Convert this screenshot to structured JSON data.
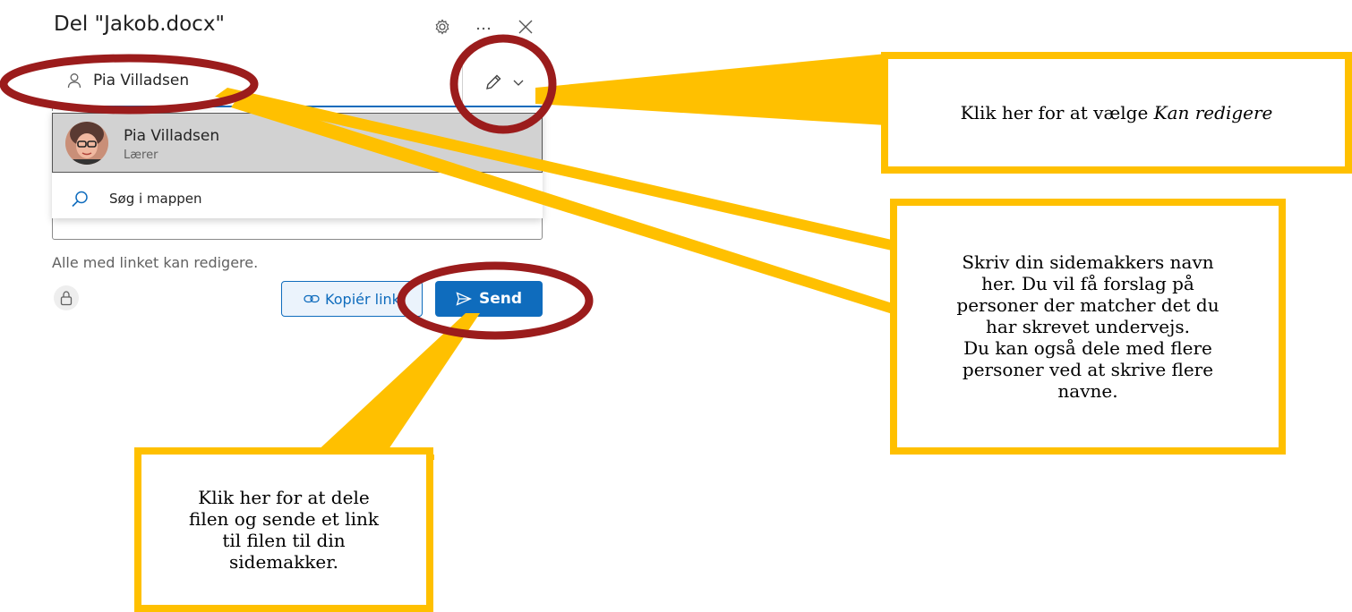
{
  "dialog": {
    "title": "Del \"Jakob.docx\"",
    "header_icons": [
      "gear-icon",
      "more-icon",
      "close-icon"
    ],
    "recipient": "Pia Villadsen",
    "suggestion": {
      "name": "Pia Villadsen",
      "role": "Lærer"
    },
    "search_folder_label": "Søg i mappen",
    "link_status": "Alle med linket kan redigere.",
    "copy_link_label": "Kopiér link",
    "send_label": "Send"
  },
  "callouts": {
    "edit_prefix": "Klik her for at vælge ",
    "edit_emphasis": "Kan redigere",
    "names": "Skriv din sidemakkers navn\nher. Du vil få forslag på\npersoner der matcher det du\nhar skrevet undervejs.\nDu kan også dele med flere\npersoner ved at skrive flere\nnavne.",
    "send": "Klik her for at dele\nfilen og sende et link\ntil filen til din\nsidemakker."
  },
  "colors": {
    "callout_border": "#ffc000",
    "circle_marker": "#9b1c1c",
    "accent": "#0f6cbd"
  }
}
